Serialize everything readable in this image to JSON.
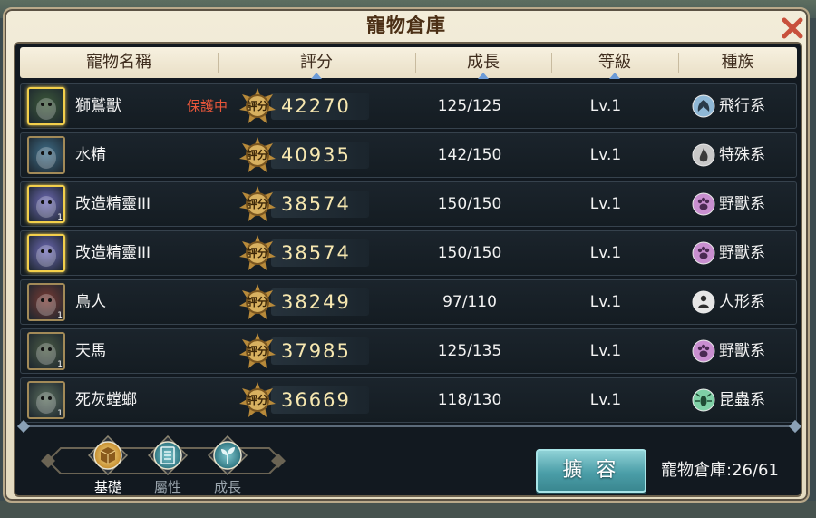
{
  "window": {
    "title": "寵物倉庫"
  },
  "columns": [
    "寵物名稱",
    "評分",
    "成長",
    "等級",
    "種族"
  ],
  "score_badge_text": "評分",
  "pets": [
    {
      "name": "獅鷲獸",
      "tag": "保護中",
      "score": "42270",
      "growth": "125/125",
      "level": "Lv.1",
      "race": "飛行系",
      "race_icon": "wing-icon",
      "race_color": "#8fb8d6",
      "highlight": true,
      "stack": ""
    },
    {
      "name": "水精",
      "tag": "",
      "score": "40935",
      "growth": "142/150",
      "level": "Lv.1",
      "race": "特殊系",
      "race_icon": "flame-icon",
      "race_color": "#c9c9c9",
      "highlight": false,
      "stack": ""
    },
    {
      "name": "改造精靈III",
      "tag": "",
      "score": "38574",
      "growth": "150/150",
      "level": "Lv.1",
      "race": "野獸系",
      "race_icon": "paw-icon",
      "race_color": "#c98fd0",
      "highlight": true,
      "stack": "1"
    },
    {
      "name": "改造精靈III",
      "tag": "",
      "score": "38574",
      "growth": "150/150",
      "level": "Lv.1",
      "race": "野獸系",
      "race_icon": "paw-icon",
      "race_color": "#c98fd0",
      "highlight": true,
      "stack": ""
    },
    {
      "name": "鳥人",
      "tag": "",
      "score": "38249",
      "growth": "97/110",
      "level": "Lv.1",
      "race": "人形系",
      "race_icon": "humanoid-icon",
      "race_color": "#e6e6e6",
      "highlight": false,
      "stack": "1"
    },
    {
      "name": "天馬",
      "tag": "",
      "score": "37985",
      "growth": "125/135",
      "level": "Lv.1",
      "race": "野獸系",
      "race_icon": "paw-icon",
      "race_color": "#c98fd0",
      "highlight": false,
      "stack": "1"
    },
    {
      "name": "死灰螳螂",
      "tag": "",
      "score": "36669",
      "growth": "118/130",
      "level": "Lv.1",
      "race": "昆蟲系",
      "race_icon": "insect-icon",
      "race_color": "#7fd0a6",
      "highlight": false,
      "stack": "1"
    }
  ],
  "tabs": [
    {
      "label": "基礎",
      "icon": "box-icon",
      "active": true
    },
    {
      "label": "屬性",
      "icon": "list-icon",
      "active": false
    },
    {
      "label": "成長",
      "icon": "sprout-icon",
      "active": false
    }
  ],
  "expand_button": "擴 容",
  "capacity": "寵物倉庫:26/61",
  "colors": {
    "accent": "#4b9ea8",
    "score_text": "#f6e7b0",
    "protect": "#e8563a"
  }
}
